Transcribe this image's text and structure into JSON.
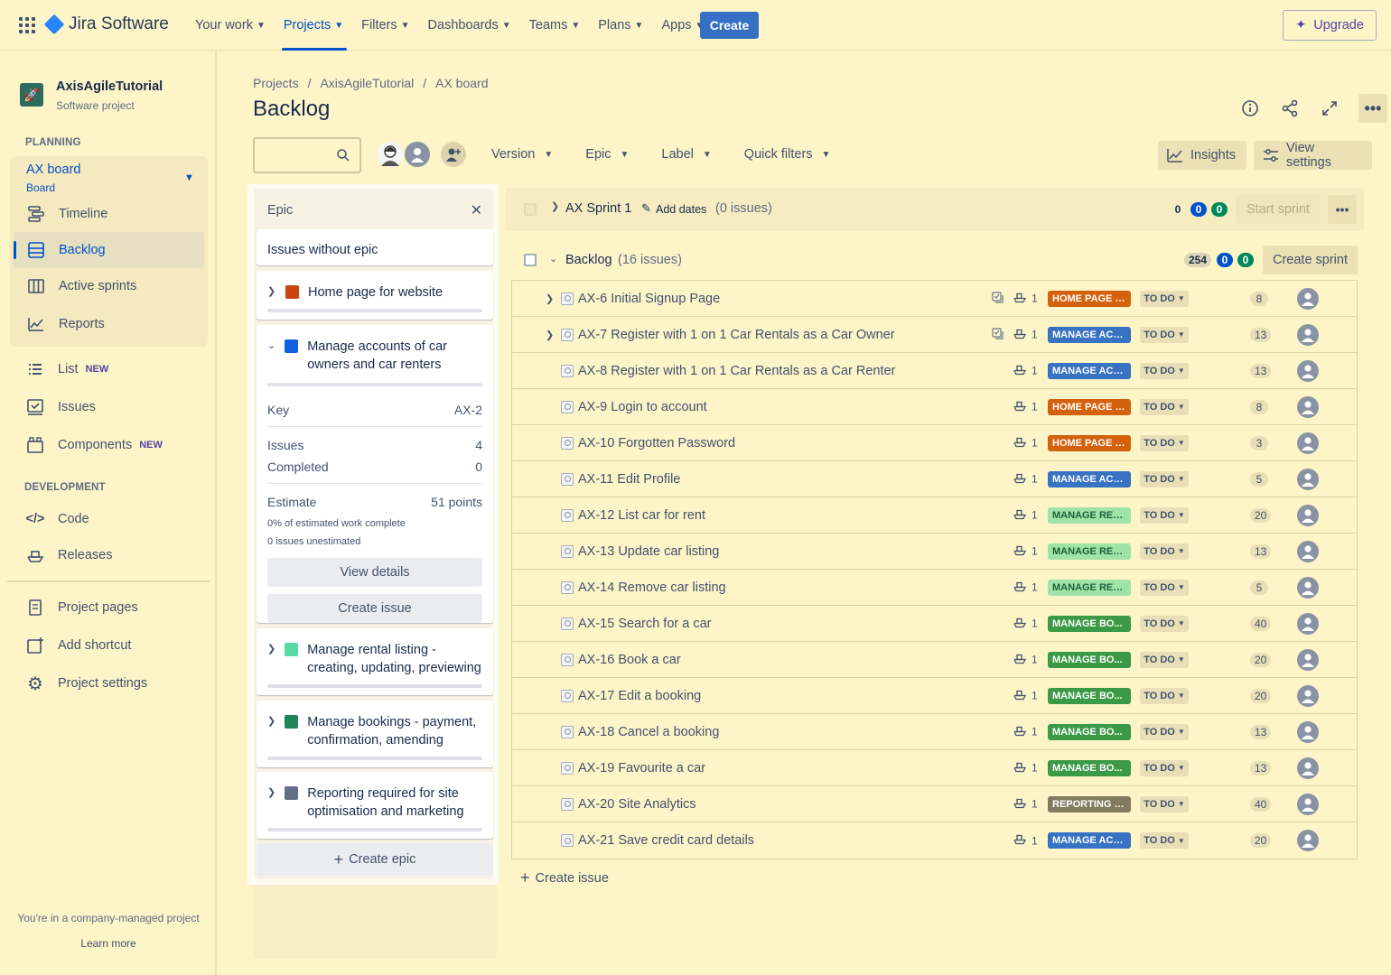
{
  "app": {
    "name": "Jira Software"
  },
  "topnav": {
    "items": [
      {
        "label": "Your work"
      },
      {
        "label": "Projects"
      },
      {
        "label": "Filters"
      },
      {
        "label": "Dashboards"
      },
      {
        "label": "Teams"
      },
      {
        "label": "Plans"
      },
      {
        "label": "Apps"
      }
    ],
    "create_label": "Create",
    "upgrade_label": "Upgrade"
  },
  "sidebar": {
    "project_name": "AxisAgileTutorial",
    "project_type": "Software project",
    "planning_label": "PLANNING",
    "board_name": "AX board",
    "board_type": "Board",
    "planning_items": [
      {
        "label": "Timeline",
        "icon": "timeline-icon"
      },
      {
        "label": "Backlog",
        "icon": "backlog-icon"
      },
      {
        "label": "Active sprints",
        "icon": "board-icon"
      },
      {
        "label": "Reports",
        "icon": "reports-icon"
      }
    ],
    "list_label": "List",
    "issues_label": "Issues",
    "components_label": "Components",
    "new_badge": "NEW",
    "development_label": "DEVELOPMENT",
    "code_label": "Code",
    "releases_label": "Releases",
    "project_pages_label": "Project pages",
    "add_shortcut_label": "Add shortcut",
    "project_settings_label": "Project settings",
    "footer_text": "You're in a company-managed project",
    "learn_more": "Learn more"
  },
  "breadcrumb": [
    "Projects",
    "AxisAgileTutorial",
    "AX board"
  ],
  "page_title": "Backlog",
  "filters": {
    "version": "Version",
    "epic": "Epic",
    "label": "Label",
    "quick": "Quick filters",
    "insights": "Insights",
    "view_settings": "View settings"
  },
  "epic_panel": {
    "title": "Epic",
    "issues_without_epic": "Issues without epic",
    "epics": [
      {
        "name": "Home page for website",
        "color": "#c9460e"
      },
      {
        "name": "Manage accounts of car owners and car renters",
        "color": "#1060e0"
      },
      {
        "name": "Manage rental listing - creating, updating, previewing",
        "color": "#57d9a3"
      },
      {
        "name": "Manage bookings - payment, confirmation, amending",
        "color": "#1f845a"
      },
      {
        "name": "Reporting required for site optimisation and marketing",
        "color": "#626f86"
      }
    ],
    "expanded": {
      "key_label": "Key",
      "key_value": "AX-2",
      "issues_label": "Issues",
      "issues_value": "4",
      "completed_label": "Completed",
      "completed_value": "0",
      "estimate_label": "Estimate",
      "estimate_value": "51 points",
      "note1": "0% of estimated work complete",
      "note2": "0 issues unestimated",
      "view_details": "View details",
      "create_issue": "Create issue"
    },
    "create_epic": "Create epic"
  },
  "sprint": {
    "name": "AX Sprint 1",
    "add_dates": "Add dates",
    "count": "(0 issues)",
    "todo": "0",
    "inprog": "0",
    "done": "0",
    "start_label": "Start sprint"
  },
  "backlog": {
    "name": "Backlog",
    "count": "(16 issues)",
    "todo": "254",
    "inprog": "0",
    "done": "0",
    "create_sprint": "Create sprint",
    "create_issue": "Create issue"
  },
  "issues": [
    {
      "summary": "AX-6 Initial Signup Page",
      "expandable": true,
      "child": true,
      "dep": "1",
      "epic": "HOME PAGE F...",
      "epic_color": "#d4620c",
      "status": "TO DO",
      "est": "8"
    },
    {
      "summary": "AX-7 Register with 1 on 1 Car Rentals as a Car Owner",
      "expandable": true,
      "child": true,
      "dep": "1",
      "epic": "MANAGE ACC...",
      "epic_color": "#3772c3",
      "status": "TO DO",
      "est": "13"
    },
    {
      "summary": "AX-8 Register with 1 on 1 Car Rentals as a Car Renter",
      "expandable": false,
      "child": false,
      "dep": "1",
      "epic": "MANAGE ACC...",
      "epic_color": "#3772c3",
      "status": "TO DO",
      "est": "13"
    },
    {
      "summary": "AX-9 Login to account",
      "expandable": false,
      "child": false,
      "dep": "1",
      "epic": "HOME PAGE F...",
      "epic_color": "#d4620c",
      "status": "TO DO",
      "est": "8"
    },
    {
      "summary": "AX-10 Forgotten Password",
      "expandable": false,
      "child": false,
      "dep": "1",
      "epic": "HOME PAGE F...",
      "epic_color": "#d4620c",
      "status": "TO DO",
      "est": "3"
    },
    {
      "summary": "AX-11 Edit Profile",
      "expandable": false,
      "child": false,
      "dep": "1",
      "epic": "MANAGE ACC...",
      "epic_color": "#3772c3",
      "status": "TO DO",
      "est": "5"
    },
    {
      "summary": "AX-12 List car for rent",
      "expandable": false,
      "child": false,
      "dep": "1",
      "epic": "MANAGE REN...",
      "epic_color": "#9fe3a7",
      "epic_text": "#1f5f3a",
      "status": "TO DO",
      "est": "20"
    },
    {
      "summary": "AX-13 Update car listing",
      "expandable": false,
      "child": false,
      "dep": "1",
      "epic": "MANAGE REN...",
      "epic_color": "#9fe3a7",
      "epic_text": "#1f5f3a",
      "status": "TO DO",
      "est": "13"
    },
    {
      "summary": "AX-14 Remove car listing",
      "expandable": false,
      "child": false,
      "dep": "1",
      "epic": "MANAGE REN...",
      "epic_color": "#9fe3a7",
      "epic_text": "#1f5f3a",
      "status": "TO DO",
      "est": "5"
    },
    {
      "summary": "AX-15 Search for a car",
      "expandable": false,
      "child": false,
      "dep": "1",
      "epic": "MANAGE BO...",
      "epic_color": "#3b9a45",
      "status": "TO DO",
      "est": "40"
    },
    {
      "summary": "AX-16 Book a car",
      "expandable": false,
      "child": false,
      "dep": "1",
      "epic": "MANAGE BO...",
      "epic_color": "#3b9a45",
      "status": "TO DO",
      "est": "20"
    },
    {
      "summary": "AX-17 Edit a booking",
      "expandable": false,
      "child": false,
      "dep": "1",
      "epic": "MANAGE BO...",
      "epic_color": "#3b9a45",
      "status": "TO DO",
      "est": "20"
    },
    {
      "summary": "AX-18 Cancel a booking",
      "expandable": false,
      "child": false,
      "dep": "1",
      "epic": "MANAGE BO...",
      "epic_color": "#3b9a45",
      "status": "TO DO",
      "est": "13"
    },
    {
      "summary": "AX-19 Favourite a car",
      "expandable": false,
      "child": false,
      "dep": "1",
      "epic": "MANAGE BO...",
      "epic_color": "#3b9a45",
      "status": "TO DO",
      "est": "13"
    },
    {
      "summary": "AX-20 Site Analytics",
      "expandable": false,
      "child": false,
      "dep": "1",
      "epic": "REPORTING R...",
      "epic_color": "#837b5f",
      "status": "TO DO",
      "est": "40"
    },
    {
      "summary": "AX-21 Save credit card details",
      "expandable": false,
      "child": false,
      "dep": "1",
      "epic": "MANAGE ACC...",
      "epic_color": "#3772c3",
      "status": "TO DO",
      "est": "20"
    }
  ]
}
